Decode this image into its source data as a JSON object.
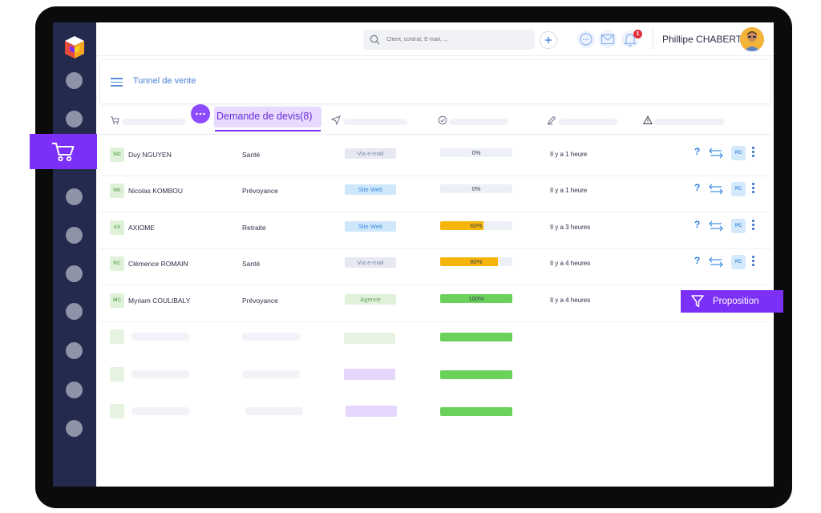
{
  "header": {
    "search_placeholder": "Client, contrat, E-mail, ...",
    "notification_count": "1",
    "user_name": "Phillipe CHABERT"
  },
  "breadcrumb": {
    "label": "Tunnel de vente"
  },
  "tabs": {
    "active_label": "Demande de devis(8)"
  },
  "rows": [
    {
      "initials": "ND",
      "name": "Duy NGUYEN",
      "category": "Santé",
      "channel": "Via e-mail",
      "progress": "0%",
      "time": "Il y a 1 heure"
    },
    {
      "initials": "NK",
      "name": "Nicolas KOMBOU",
      "category": "Prévoyance",
      "channel": "Site Web",
      "progress": "0%",
      "time": "Il y a 1 heure"
    },
    {
      "initials": "AX",
      "name": "AXIOME",
      "category": "Retraite",
      "channel": "Site Web",
      "progress": "60%",
      "time": "Il y a 3 heures"
    },
    {
      "initials": "RC",
      "name": "Clémence ROMAIN",
      "category": "Santé",
      "channel": "Via e-mail",
      "progress": "80%",
      "time": "Il y a 4 heures"
    },
    {
      "initials": "MC",
      "name": "Myriam COULIBALY",
      "category": "Prévoyance",
      "channel": "Agence",
      "progress": "100%",
      "time": "Il y a 4 heures"
    }
  ],
  "actions": {
    "help": "?",
    "pc": "PC"
  },
  "proposition_label": "Proposition",
  "colors": {
    "accent": "#7b2ff7",
    "sidebar": "#232a4e",
    "progress_partial": "#f5b50a",
    "progress_complete": "#6ad15a"
  }
}
